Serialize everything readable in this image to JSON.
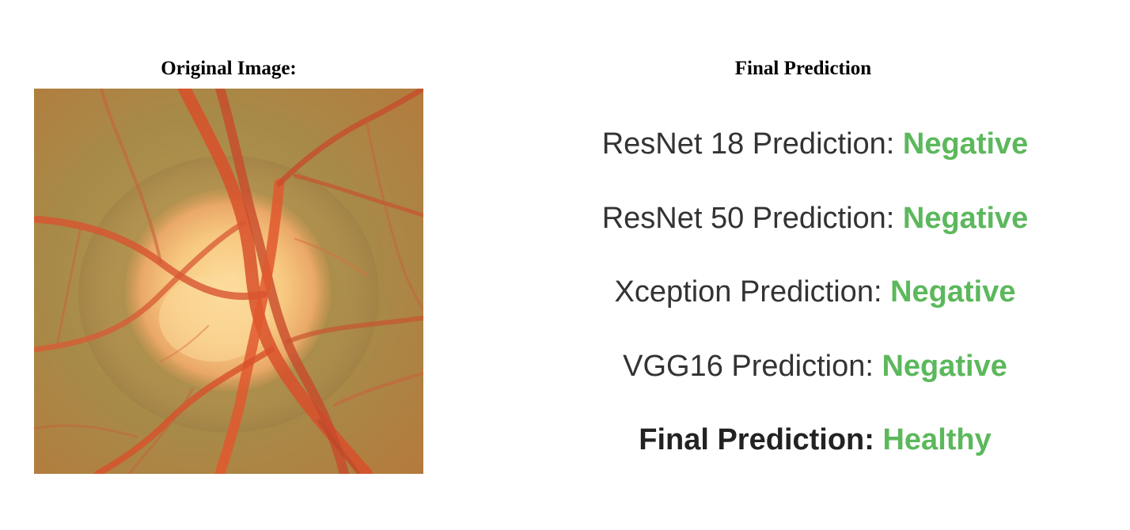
{
  "left_panel": {
    "title": "Original Image:"
  },
  "right_panel": {
    "title": "Final Prediction",
    "accent_color": "#5cb85c",
    "predictions": [
      {
        "label": "ResNet 18 Prediction: ",
        "value": "Negative"
      },
      {
        "label": "ResNet 50 Prediction: ",
        "value": "Negative"
      },
      {
        "label": "Xception Prediction: ",
        "value": "Negative"
      },
      {
        "label": "VGG16 Prediction: ",
        "value": "Negative"
      }
    ],
    "final": {
      "label": "Final Prediction: ",
      "value": "Healthy"
    }
  }
}
